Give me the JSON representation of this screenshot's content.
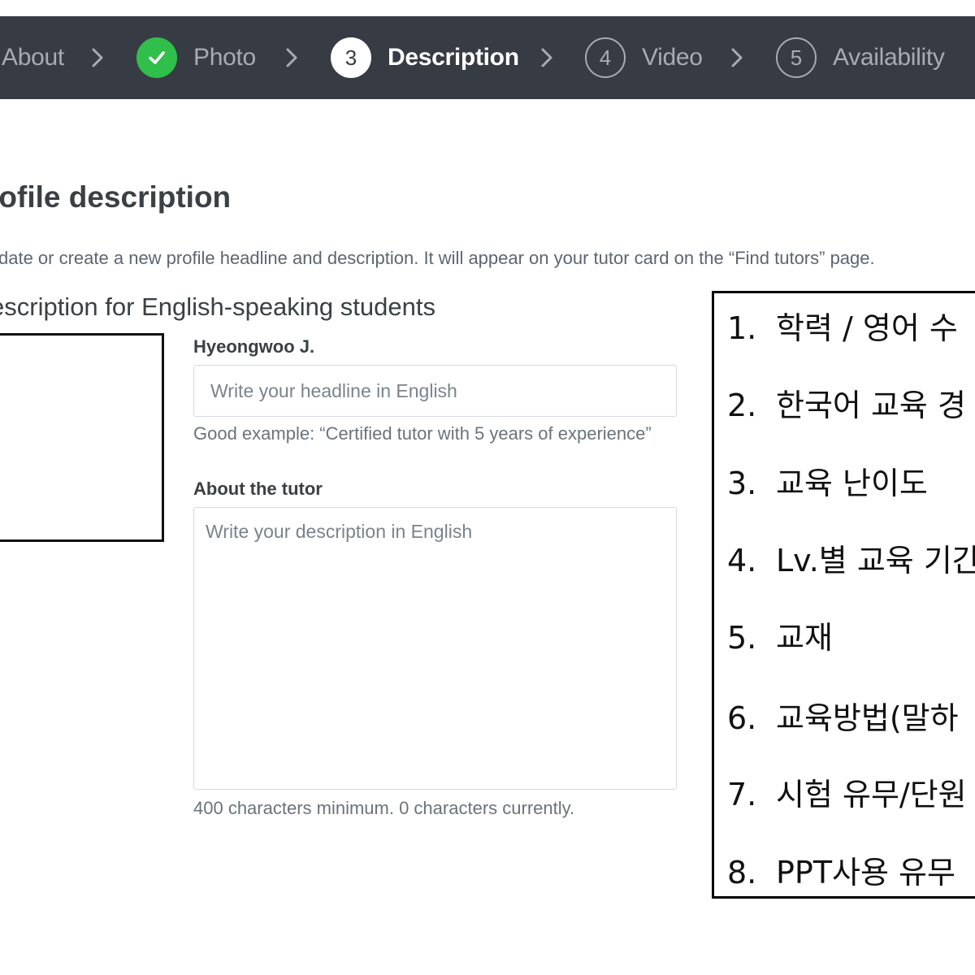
{
  "stepper": {
    "steps": [
      {
        "label": "About",
        "state": "partial"
      },
      {
        "label": "Photo",
        "state": "done"
      },
      {
        "label": "Description",
        "number": "3",
        "state": "current"
      },
      {
        "label": "Video",
        "number": "4",
        "state": "todo"
      },
      {
        "label": "Availability",
        "number": "5",
        "state": "todo"
      }
    ],
    "icons": {
      "separator": "chevron-right-icon",
      "done": "check-icon"
    }
  },
  "page": {
    "title": "rofile description",
    "subtitle": "date or create a new profile headline and description. It will appear on your tutor card on the “Find tutors” page.",
    "section_title": "escription for English-speaking students"
  },
  "form": {
    "tutor_name": "Hyeongwoo J.",
    "headline": {
      "value": "",
      "placeholder": "Write your headline in English",
      "hint": "Good example: “Certified tutor with 5 years of experience”"
    },
    "about": {
      "label": "About the tutor",
      "value": "",
      "placeholder": "Write your description in English",
      "counter": "400 characters minimum. 0 characters currently."
    }
  },
  "notes": {
    "items": [
      {
        "num": "1.",
        "text": "학력 / 영어 수"
      },
      {
        "num": "2.",
        "text": "한국어 교육 경"
      },
      {
        "num": "3.",
        "text": "교육 난이도"
      },
      {
        "num": "4.",
        "text": "Lv.별 교육 기간"
      },
      {
        "num": "5.",
        "text": "교재"
      },
      {
        "num": "6.",
        "text": "교육방법(말하"
      },
      {
        "num": "7.",
        "text": "시험 유무/단원"
      },
      {
        "num": "8.",
        "text": "PPT사용 유무"
      }
    ]
  },
  "colors": {
    "stepper_bg": "#373c44",
    "step_inactive": "#a7abb2",
    "done_green": "#2fbf4a",
    "text_primary": "#3b4044"
  }
}
